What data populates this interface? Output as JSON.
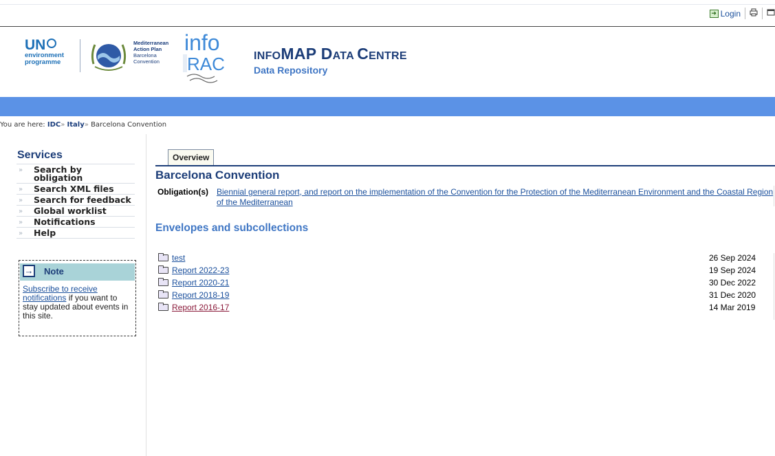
{
  "toolbar": {
    "login_label": "Login",
    "login_icon": "login-icon",
    "print_icon": "print-icon",
    "fullscreen_icon": "fullscreen-icon"
  },
  "header": {
    "unep": {
      "line1": "UN",
      "line2": "environment",
      "line3": "programme"
    },
    "map": {
      "line1": "Mediterranean",
      "line2": "Action Plan",
      "line3": "Barcelona",
      "line4": "Convention"
    },
    "inforac": {
      "top": "info",
      "bottom": "RAC"
    },
    "title_a": "INFO",
    "title_b": "MAP ",
    "title_c": "D",
    "title_d": "ATA ",
    "title_e": "C",
    "title_f": "ENTRE",
    "subtitle": "Data Repository"
  },
  "breadcrumb": {
    "prefix": "You are here: ",
    "items": [
      "IDC",
      "Italy",
      "Barcelona Convention"
    ],
    "separator": "»"
  },
  "sidebar": {
    "title": "Services",
    "items": [
      {
        "label": "Search by obligation"
      },
      {
        "label": "Search XML files"
      },
      {
        "label": "Search for feedback"
      },
      {
        "label": "Global worklist"
      },
      {
        "label": "Notifications"
      },
      {
        "label": "Help"
      }
    ],
    "note": {
      "title": "Note",
      "link_text": "Subscribe to receive notifications",
      "rest_text": " if you want to stay updated about events in this site."
    }
  },
  "main": {
    "tab_label": "Overview",
    "title": "Barcelona Convention",
    "obligation_label": "Obligation(s)",
    "obligation_text": "Biennial general report, and report on the implementation of the Convention for the Protection of the Mediterranean Environment and the Coastal Region of the Mediterranean",
    "envelopes_title": "Envelopes and subcollections",
    "envelopes": [
      {
        "name": "test",
        "date": "26 Sep 2024"
      },
      {
        "name": "Report 2022-23",
        "date": "19 Sep 2024"
      },
      {
        "name": "Report 2020-21",
        "date": "30 Dec 2022"
      },
      {
        "name": "Report 2018-19",
        "date": "31 Dec 2020"
      },
      {
        "name": "Report 2016-17",
        "date": "14 Mar 2019"
      }
    ]
  },
  "colors": {
    "band": "#5b92e6",
    "title_navy": "#1c3d78",
    "link_blue": "#1a4f9c",
    "visited_link": "#8a1a3a",
    "note_header": "#a9d3d8"
  }
}
